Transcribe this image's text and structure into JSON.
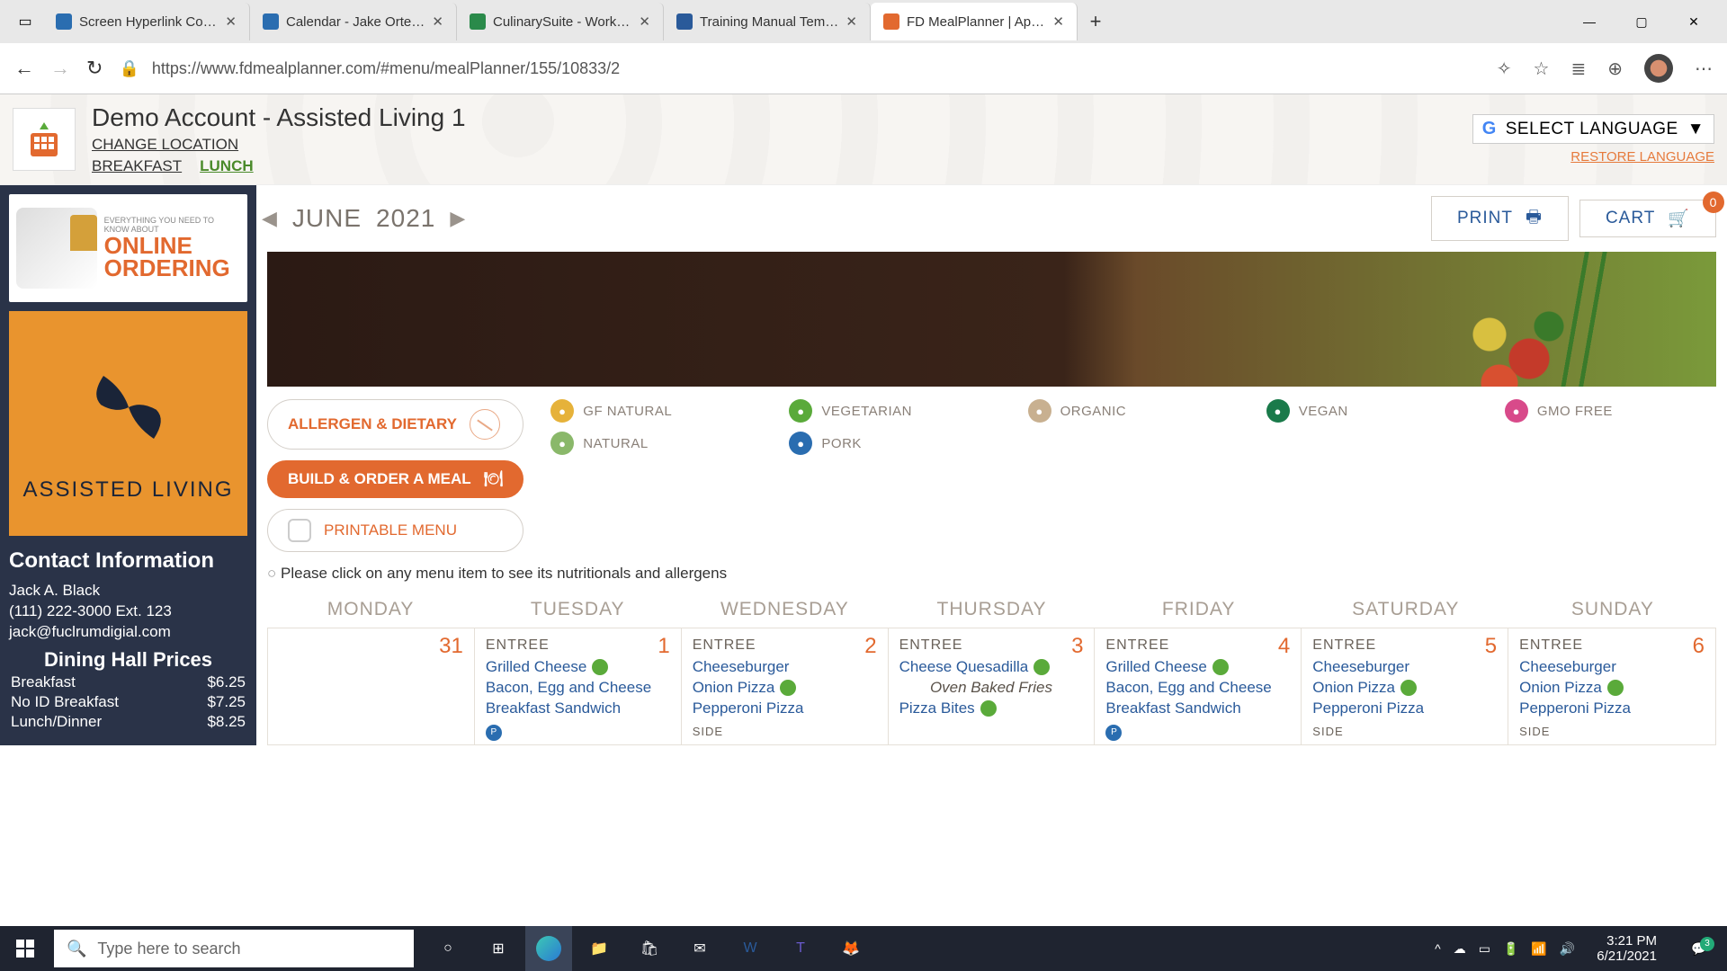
{
  "browser": {
    "tabs": [
      {
        "title": "Screen Hyperlink Configur",
        "icon_color": "#2a6db0"
      },
      {
        "title": "Calendar - Jake Ortega - C",
        "icon_color": "#2a6db0"
      },
      {
        "title": "CulinarySuite - Workflow &",
        "icon_color": "#2a8a4a"
      },
      {
        "title": "Training Manual Template",
        "icon_color": "#2a5a9a"
      },
      {
        "title": "FD MealPlanner | Applicat",
        "icon_color": "#e2692f",
        "active": true
      }
    ],
    "url": "https://www.fdmealplanner.com/#menu/mealPlanner/155/10833/2"
  },
  "header": {
    "account_title": "Demo Account - Assisted Living 1",
    "change_location": "CHANGE LOCATION",
    "meal_tabs": {
      "breakfast": "BREAKFAST",
      "lunch": "LUNCH"
    },
    "lang_select": "SELECT LANGUAGE",
    "lang_restore": "RESTORE LANGUAGE"
  },
  "sidebar": {
    "promo_small": "EVERYTHING YOU NEED TO KNOW ABOUT",
    "promo_big1": "ONLINE",
    "promo_big2": "ORDERING",
    "assisted_label": "ASSISTED LIVING",
    "contact_heading": "Contact Information",
    "contact_name": "Jack A. Black",
    "contact_phone": "(111) 222-3000 Ext. 123",
    "contact_email": "jack@fuclrumdigial.com",
    "prices_heading": "Dining Hall Prices",
    "prices": [
      {
        "label": "Breakfast",
        "price": "$6.25"
      },
      {
        "label": "No ID Breakfast",
        "price": "$7.25"
      },
      {
        "label": "Lunch/Dinner",
        "price": "$8.25"
      }
    ]
  },
  "toolbar": {
    "month": "JUNE",
    "year": "2021",
    "print": "PRINT",
    "cart": "CART",
    "cart_count": "0"
  },
  "filters": {
    "allergen": "ALLERGEN & DIETARY",
    "build": "BUILD & ORDER A MEAL",
    "printable": "PRINTABLE MENU",
    "legend": [
      {
        "label": "GF NATURAL",
        "color": "#e6b23a"
      },
      {
        "label": "VEGETARIAN",
        "color": "#5aaa3a"
      },
      {
        "label": "ORGANIC",
        "color": "#c8b090"
      },
      {
        "label": "VEGAN",
        "color": "#1a7a4a"
      },
      {
        "label": "GMO FREE",
        "color": "#d84a8a"
      },
      {
        "label": "NATURAL",
        "color": "#8ab86a"
      },
      {
        "label": "PORK",
        "color": "#2a6db0"
      }
    ]
  },
  "note": "Please click on any menu item to see its nutritionals and allergens",
  "dow": [
    "MONDAY",
    "TUESDAY",
    "WEDNESDAY",
    "THURSDAY",
    "FRIDAY",
    "SATURDAY",
    "SUNDAY"
  ],
  "entree_label": "ENTREE",
  "side_label": "SIDE",
  "cells": [
    {
      "num": "31",
      "items": []
    },
    {
      "num": "1",
      "items": [
        {
          "t": "Grilled Cheese",
          "b": "veg"
        },
        {
          "t": "Bacon, Egg and Cheese Breakfast Sandwich",
          "b": "pork"
        }
      ]
    },
    {
      "num": "2",
      "items": [
        {
          "t": "Cheeseburger"
        },
        {
          "t": "Onion Pizza",
          "b": "veg"
        },
        {
          "t": "Pepperoni Pizza"
        }
      ],
      "side": true
    },
    {
      "num": "3",
      "items": [
        {
          "t": "Cheese Quesadilla",
          "b": "veg"
        },
        {
          "t": "Oven Baked Fries",
          "alt": true
        },
        {
          "t": "Pizza Bites",
          "b": "veg"
        }
      ]
    },
    {
      "num": "4",
      "items": [
        {
          "t": "Grilled Cheese",
          "b": "veg"
        },
        {
          "t": "Bacon, Egg and Cheese Breakfast Sandwich",
          "b": "pork"
        }
      ]
    },
    {
      "num": "5",
      "items": [
        {
          "t": "Cheeseburger"
        },
        {
          "t": "Onion Pizza",
          "b": "veg"
        },
        {
          "t": "Pepperoni Pizza"
        }
      ],
      "side": true
    },
    {
      "num": "6",
      "items": [
        {
          "t": "Cheeseburger"
        },
        {
          "t": "Onion Pizza",
          "b": "veg"
        },
        {
          "t": "Pepperoni Pizza"
        }
      ],
      "side": true
    }
  ],
  "taskbar": {
    "search_placeholder": "Type here to search",
    "time": "3:21 PM",
    "date": "6/21/2021",
    "notif_count": "3"
  }
}
